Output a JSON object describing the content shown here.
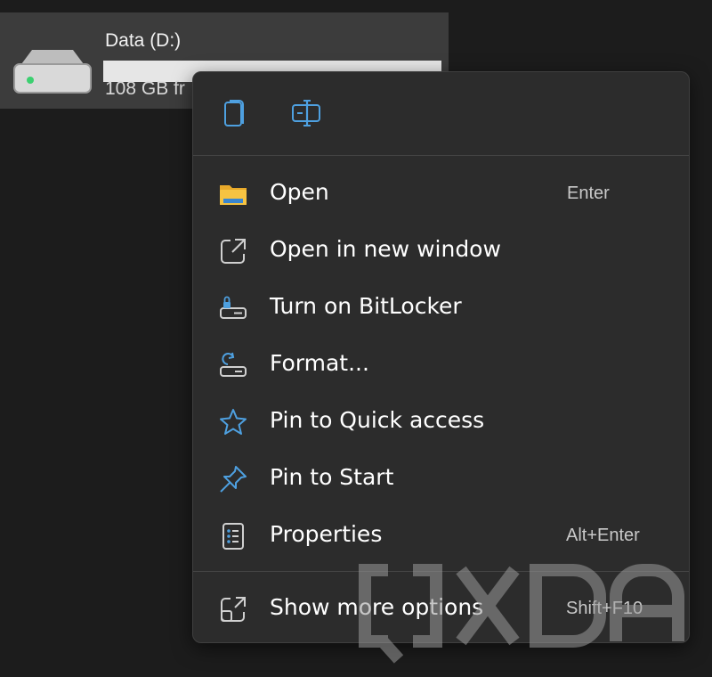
{
  "drive": {
    "name": "Data (D:)",
    "free_text": "108 GB fr",
    "usage_fraction": 0
  },
  "quick_actions": [
    {
      "name": "copy",
      "icon": "copy-icon"
    },
    {
      "name": "rename",
      "icon": "rename-icon"
    }
  ],
  "menu": {
    "items": [
      {
        "label": "Open",
        "shortcut": "Enter",
        "icon": "folder-icon"
      },
      {
        "label": "Open in new window",
        "shortcut": "",
        "icon": "open-new-window-icon"
      },
      {
        "label": "Turn on BitLocker",
        "shortcut": "",
        "icon": "bitlocker-key-icon"
      },
      {
        "label": "Format...",
        "shortcut": "",
        "icon": "format-drive-icon"
      },
      {
        "label": "Pin to Quick access",
        "shortcut": "",
        "icon": "star-icon"
      },
      {
        "label": "Pin to Start",
        "shortcut": "",
        "icon": "pin-icon"
      },
      {
        "label": "Properties",
        "shortcut": "Alt+Enter",
        "icon": "properties-icon"
      },
      {
        "label": "Show more options",
        "shortcut": "Shift+F10",
        "icon": "show-more-options-icon"
      }
    ]
  },
  "colors": {
    "background": "#1c1c1c",
    "menu_background": "#2c2c2c",
    "accent": "#4ea0e0",
    "folder": "#f6c342"
  }
}
